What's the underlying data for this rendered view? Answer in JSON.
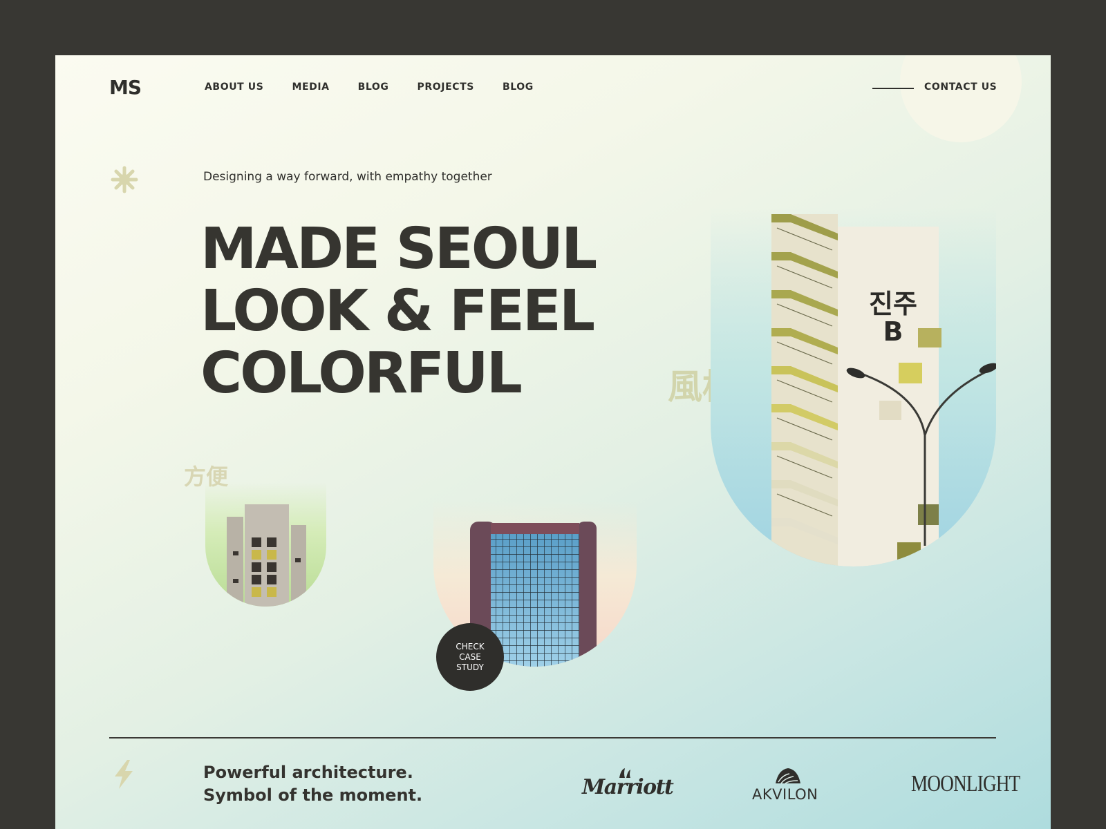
{
  "header": {
    "logo": "MS",
    "nav": [
      "ABOUT US",
      "MEDIA",
      "BLOG",
      "PROJECTS",
      "BLOG"
    ],
    "contact": "CONTACT US"
  },
  "hero": {
    "tagline": "Designing a way forward, with empathy together",
    "headline_lines": [
      "MADE SEOUL",
      "LOOK & FEEL",
      "COLORFUL"
    ],
    "cta_lines": [
      "CHECK",
      "CASE",
      "STUDY"
    ]
  },
  "decor": {
    "cjk_small": "方便",
    "cjk_large": "風格",
    "building_sign_line1": "진주",
    "building_sign_line2": "B"
  },
  "footer": {
    "statement_lines": [
      "Powerful architecture.",
      "Symbol of the moment."
    ],
    "brands": [
      "Marriott",
      "AKVILON",
      "MOONLIGHT"
    ]
  },
  "colors": {
    "frame_bg": "#383733",
    "ink": "#2f2f2c",
    "accent_olive": "#d8d6b3",
    "cta_bg": "#2f2e2b"
  },
  "icons": {
    "star": "star-icon",
    "bolt": "bolt-icon"
  }
}
